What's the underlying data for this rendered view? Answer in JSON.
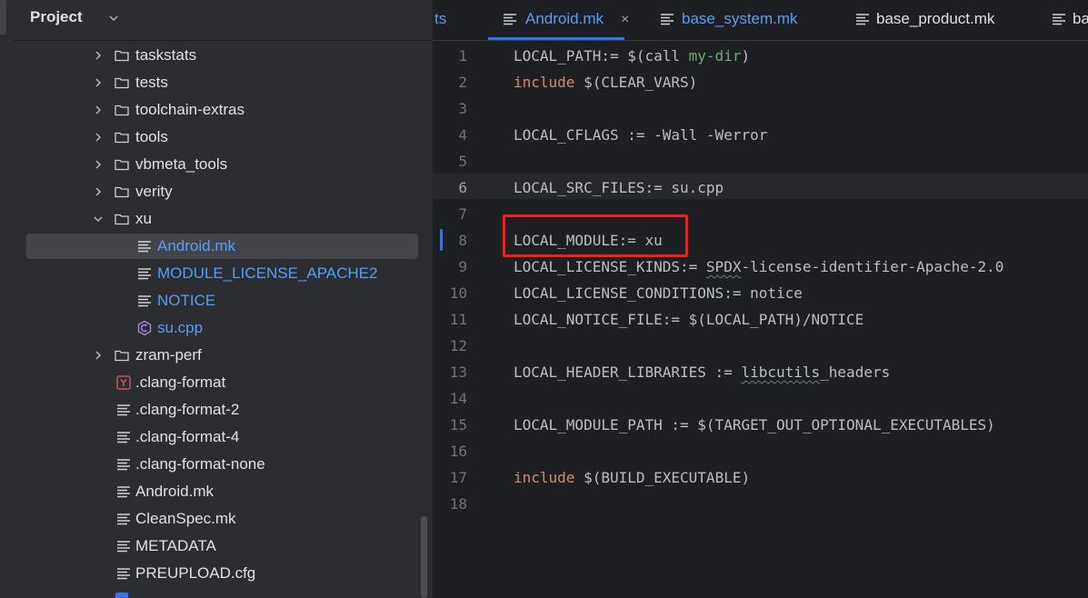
{
  "project_panel": {
    "title": "Project",
    "tree": [
      {
        "label": "taskstats",
        "type": "folder",
        "expanded": false
      },
      {
        "label": "tests",
        "type": "folder",
        "expanded": false
      },
      {
        "label": "toolchain-extras",
        "type": "folder",
        "expanded": false
      },
      {
        "label": "tools",
        "type": "folder",
        "expanded": false
      },
      {
        "label": "vbmeta_tools",
        "type": "folder",
        "expanded": false
      },
      {
        "label": "verity",
        "type": "folder",
        "expanded": false
      },
      {
        "label": "xu",
        "type": "folder",
        "expanded": true
      },
      {
        "label": "Android.mk",
        "type": "text-file",
        "selected": true
      },
      {
        "label": "MODULE_LICENSE_APACHE2",
        "type": "text-file"
      },
      {
        "label": "NOTICE",
        "type": "text-file"
      },
      {
        "label": "su.cpp",
        "type": "cpp-file"
      },
      {
        "label": "zram-perf",
        "type": "folder",
        "expanded": false
      },
      {
        "label": ".clang-format",
        "type": "yaml-file"
      },
      {
        "label": ".clang-format-2",
        "type": "text-file"
      },
      {
        "label": ".clang-format-4",
        "type": "text-file"
      },
      {
        "label": ".clang-format-none",
        "type": "text-file"
      },
      {
        "label": "Android.mk",
        "type": "text-file"
      },
      {
        "label": "CleanSpec.mk",
        "type": "text-file"
      },
      {
        "label": "METADATA",
        "type": "text-file"
      },
      {
        "label": "PREUPLOAD.cfg",
        "type": "text-file"
      }
    ]
  },
  "editor": {
    "tabs": [
      {
        "label": "ts",
        "active": false
      },
      {
        "label": "Android.mk",
        "active": true
      },
      {
        "label": "base_system.mk",
        "active": false
      },
      {
        "label": "base_product.mk",
        "active": false
      },
      {
        "label": "ba",
        "active": false
      }
    ],
    "line_numbers": [
      "1",
      "2",
      "3",
      "4",
      "5",
      "6",
      "7",
      "8",
      "9",
      "10",
      "11",
      "12",
      "13",
      "14",
      "15",
      "16",
      "17",
      "18"
    ],
    "current_line": 6,
    "code": {
      "l1_a": "LOCAL_PATH:= $(call ",
      "l1_fn": "my-dir",
      "l1_b": ")",
      "l2_kw": "include",
      "l2_b": " $(CLEAR_VARS)",
      "l4": "LOCAL_CFLAGS := -Wall -Werror",
      "l6": "LOCAL_SRC_FILES:= su.cpp",
      "l8": "LOCAL_MODULE:= xu",
      "l9_a": "LOCAL_LICENSE_KINDS:= ",
      "l9_sq": "SPDX",
      "l9_b": "-license-identifier-Apache-2.0",
      "l10": "LOCAL_LICENSE_CONDITIONS:= notice",
      "l11": "LOCAL_NOTICE_FILE:= $(LOCAL_PATH)/NOTICE",
      "l13_a": "LOCAL_HEADER_LIBRARIES := ",
      "l13_sq": "libcutils",
      "l13_b": "_headers",
      "l15": "LOCAL_MODULE_PATH := $(TARGET_OUT_OPTIONAL_EXECUTABLES)",
      "l17_kw": "include",
      "l17_b": " $(BUILD_EXECUTABLE)"
    }
  },
  "colors": {
    "accent": "#3574f0",
    "highlight_box": "#ff1a1a",
    "keyword": "#cf8e6d",
    "function": "#6aab73",
    "link": "#589df6"
  }
}
